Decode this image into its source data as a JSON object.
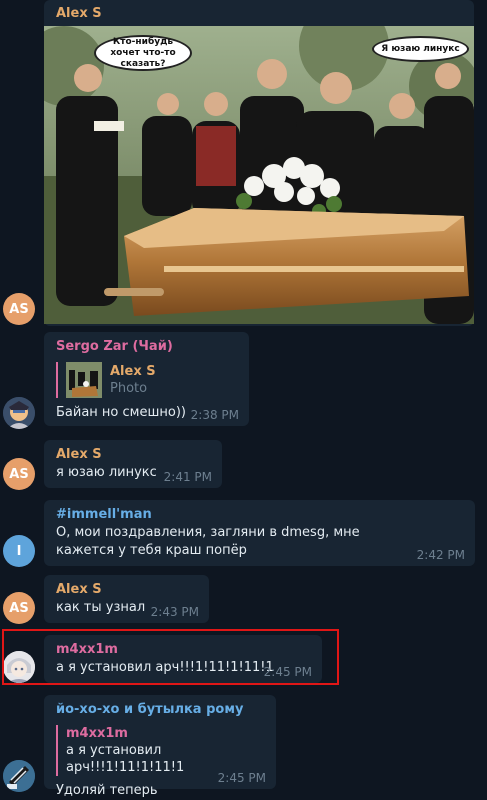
{
  "colors": {
    "background": "#0e1621",
    "bubble": "#182533",
    "name_orange": "#e4a96a",
    "name_pink": "#de6ca0",
    "name_blue": "#67aee6",
    "time": "#6d7f8f",
    "highlight_red": "#e01616"
  },
  "messages": [
    {
      "sender": "Alex S",
      "avatar_initials": "AS",
      "image": {
        "bubble_left": "Кто-нибудь хочет что-то сказать?",
        "bubble_right": "Я юзаю линукс"
      }
    },
    {
      "sender": "Sergo Zar (Чай)",
      "reply": {
        "name": "Alex S",
        "text": "Photo"
      },
      "text": "Байан но смешно))",
      "time": "2:38 PM"
    },
    {
      "sender": "Alex S",
      "avatar_initials": "AS",
      "text": "я юзаю линукс",
      "time": "2:41 PM"
    },
    {
      "sender": "#immell'man",
      "avatar_initials": "I",
      "text": "О, мои поздравления, загляни в dmesg, мне кажется у тебя краш попёр",
      "time": "2:42 PM"
    },
    {
      "sender": "Alex S",
      "avatar_initials": "AS",
      "text": "как ты узнал",
      "time": "2:43 PM"
    },
    {
      "sender": "m4xx1m",
      "text": "а я установил арч!!!1!11!1!11!1",
      "time": "2:45 PM"
    },
    {
      "sender": "йо-хо-хо и бутылка рому",
      "reply": {
        "name": "m4xx1m",
        "text": "а я установил арч!!!1!11!1!11!1"
      },
      "text": "Удоляй теперь",
      "time": "2:45 PM"
    }
  ]
}
